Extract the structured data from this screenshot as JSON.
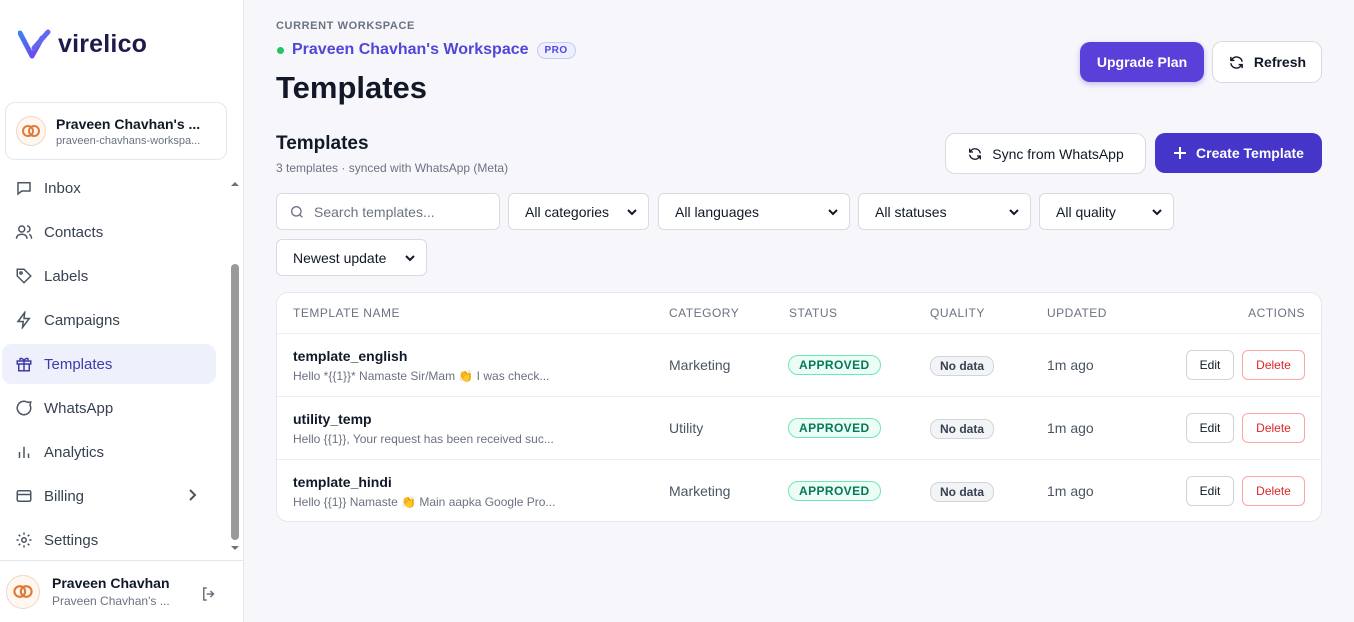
{
  "brand": {
    "name": "virelico"
  },
  "workspace_card": {
    "name": "Praveen Chavhan's ...",
    "slug": "praveen-chavhans-workspa..."
  },
  "nav": [
    {
      "id": "inbox",
      "label": "Inbox",
      "icon": "inbox-icon",
      "active": false
    },
    {
      "id": "contacts",
      "label": "Contacts",
      "icon": "users-icon",
      "active": false
    },
    {
      "id": "labels",
      "label": "Labels",
      "icon": "tag-icon",
      "active": false
    },
    {
      "id": "campaigns",
      "label": "Campaigns",
      "icon": "lightning-icon",
      "active": false
    },
    {
      "id": "templates",
      "label": "Templates",
      "icon": "gift-icon",
      "active": true
    },
    {
      "id": "whatsapp",
      "label": "WhatsApp",
      "icon": "chat-bubble-icon",
      "active": false
    },
    {
      "id": "analytics",
      "label": "Analytics",
      "icon": "bar-chart-icon",
      "active": false
    },
    {
      "id": "billing",
      "label": "Billing",
      "icon": "credit-card-icon",
      "active": false
    },
    {
      "id": "settings",
      "label": "Settings",
      "icon": "gear-icon",
      "active": false
    }
  ],
  "user": {
    "name": "Praveen Chavhan",
    "sub": "Praveen Chavhan's ..."
  },
  "header": {
    "workspace_label": "CURRENT WORKSPACE",
    "workspace_name": "Praveen Chavhan's Workspace",
    "plan_badge": "PRO",
    "title": "Templates",
    "upgrade_label": "Upgrade Plan",
    "refresh_label": "Refresh"
  },
  "section": {
    "title": "Templates",
    "subtitle": "3 templates · synced with WhatsApp (Meta)",
    "sync_label": "Sync from WhatsApp",
    "create_label": "Create Template"
  },
  "filters": {
    "search_placeholder": "Search templates...",
    "category": "All categories",
    "language": "All languages",
    "status": "All statuses",
    "quality": "All quality",
    "sort": "Newest update"
  },
  "table": {
    "columns": [
      "TEMPLATE NAME",
      "CATEGORY",
      "STATUS",
      "QUALITY",
      "UPDATED",
      "ACTIONS"
    ],
    "rows": [
      {
        "name": "template_english",
        "preview": "Hello *{{1}}* Namaste Sir/Mam 👏 I was check...",
        "category": "Marketing",
        "status": "APPROVED",
        "quality": "No data",
        "updated": "1m ago",
        "edit": "Edit",
        "delete": "Delete"
      },
      {
        "name": "utility_temp",
        "preview": "Hello {{1}}, Your request has been received suc...",
        "category": "Utility",
        "status": "APPROVED",
        "quality": "No data",
        "updated": "1m ago",
        "edit": "Edit",
        "delete": "Delete"
      },
      {
        "name": "template_hindi",
        "preview": "Hello {{1}} Namaste 👏 Main aapka Google Pro...",
        "category": "Marketing",
        "status": "APPROVED",
        "quality": "No data",
        "updated": "1m ago",
        "edit": "Edit",
        "delete": "Delete"
      }
    ]
  },
  "colors": {
    "accent": "#4536c9",
    "upgrade": "#5b3fd9",
    "approved": "#047857",
    "danger": "#dc2626",
    "online": "#22c55e"
  }
}
